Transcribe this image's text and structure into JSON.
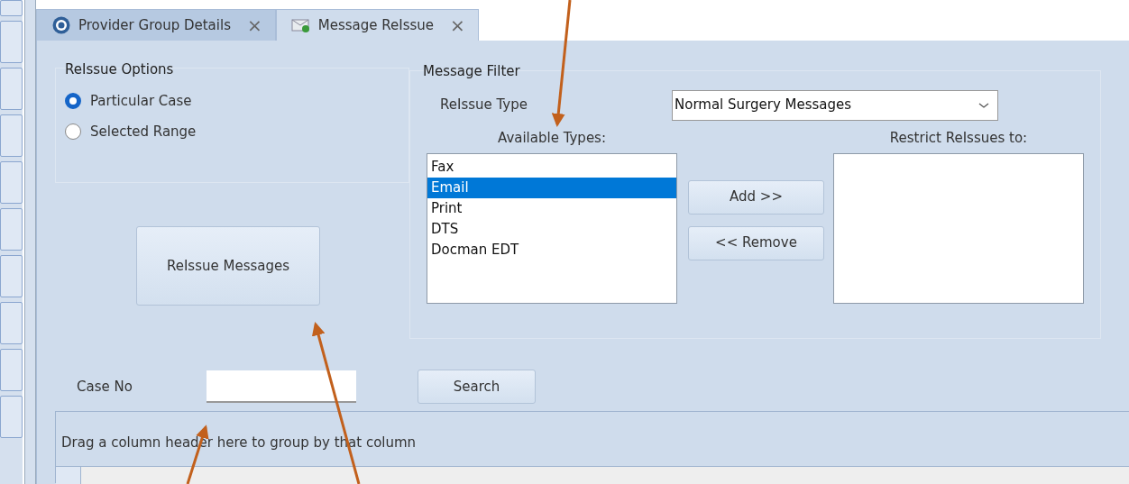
{
  "tabs": [
    {
      "label": "Provider Group Details",
      "close": "×",
      "selected": false,
      "kind": "provider"
    },
    {
      "label": "Message ReIssue",
      "close": "×",
      "selected": true,
      "kind": "message"
    }
  ],
  "reissue_options": {
    "title": "ReIssue Options",
    "options": [
      {
        "label": "Particular Case",
        "selected": true
      },
      {
        "label": "Selected Range",
        "selected": false
      }
    ]
  },
  "reissue_button": "ReIssue Messages",
  "message_filter": {
    "title": "Message Filter",
    "reissue_type_label": "ReIssue Type",
    "reissue_type_value": "Normal Surgery Messages",
    "available_label": "Available Types:",
    "available_types": [
      {
        "label": "Fax",
        "selected": false
      },
      {
        "label": "Email",
        "selected": true
      },
      {
        "label": "Print",
        "selected": false
      },
      {
        "label": "DTS",
        "selected": false
      },
      {
        "label": "Docman EDT",
        "selected": false
      }
    ],
    "add_button": "Add >>",
    "remove_button": "<< Remove",
    "restrict_label": "Restrict ReIssues to:"
  },
  "case_no": {
    "label": "Case No"
  },
  "search_button": "Search",
  "grid": {
    "group_panel_text": "Drag a column header here to group by that column"
  }
}
